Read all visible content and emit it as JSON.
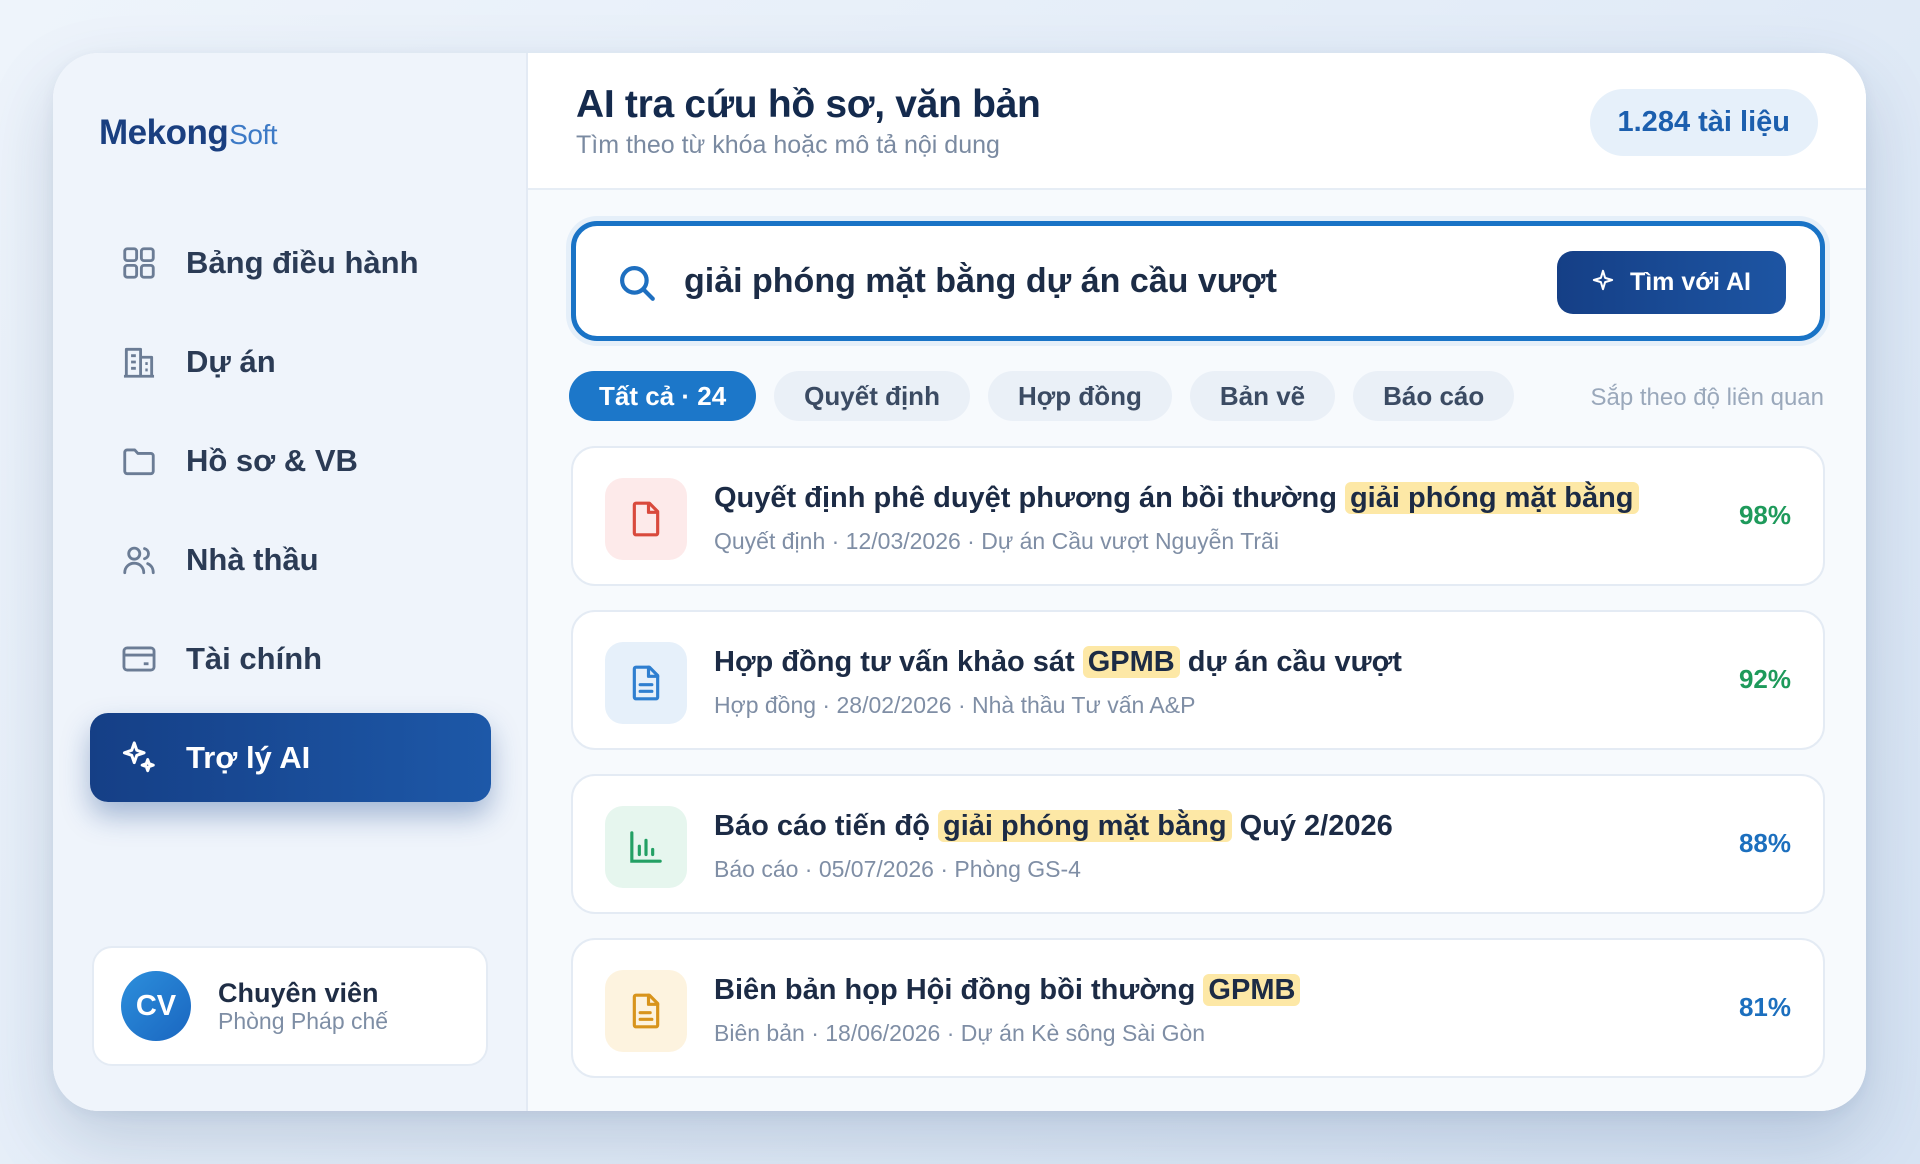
{
  "brand": {
    "name_main": "Mekong",
    "name_suffix": "Soft"
  },
  "sidebar": {
    "items": [
      {
        "label": "Bảng điều hành",
        "icon": "grid-icon"
      },
      {
        "label": "Dự án",
        "icon": "building-icon"
      },
      {
        "label": "Hồ sơ & VB",
        "icon": "folder-icon"
      },
      {
        "label": "Nhà thầu",
        "icon": "users-icon"
      },
      {
        "label": "Tài chính",
        "icon": "wallet-icon"
      },
      {
        "label": "Trợ lý AI",
        "icon": "sparkles-icon",
        "active": true
      }
    ]
  },
  "user": {
    "initials": "CV",
    "name": "Chuyên viên",
    "department": "Phòng Pháp chế"
  },
  "header": {
    "title": "AI tra cứu hồ sơ, văn bản",
    "subtitle": "Tìm theo từ khóa hoặc mô tả nội dung",
    "doc_count": "1.284 tài liệu"
  },
  "search": {
    "value": "giải phóng mặt bằng dự án cầu vượt",
    "button_label": "Tìm với AI"
  },
  "filters": [
    "Tất cả · 24",
    "Quyết định",
    "Hợp đồng",
    "Bản vẽ",
    "Báo cáo"
  ],
  "active_filter": 0,
  "sort_label": "Sắp theo độ liên quan",
  "results": [
    {
      "title_before": "Quyết định phê duyệt phương án bồi thường ",
      "highlight": "giải phóng mặt bằng",
      "title_after": "",
      "meta": "Quyết định · 12/03/2026 · Dự án Cầu vượt Nguyễn Trãi",
      "score": "98%",
      "icon": "document-icon",
      "icon_color": "#d94a3d",
      "icon_bg": "#fdeaea",
      "score_color": "#1e9a5b"
    },
    {
      "title_before": "Hợp đồng tư vấn khảo sát ",
      "highlight": "GPMB",
      "title_after": " dự án cầu vượt",
      "meta": "Hợp đồng · 28/02/2026 · Nhà thầu Tư vấn A&P",
      "score": "92%",
      "icon": "contract-icon",
      "icon_color": "#2f7fd0",
      "icon_bg": "#e6f0fa",
      "score_color": "#1e9a5b"
    },
    {
      "title_before": "Báo cáo tiến độ ",
      "highlight": "giải phóng mặt bằng",
      "title_after": " Quý 2/2026",
      "meta": "Báo cáo · 05/07/2026 · Phòng GS-4",
      "score": "88%",
      "icon": "chart-icon",
      "icon_color": "#23a064",
      "icon_bg": "#e6f6ee",
      "score_color": "#1c6fbe"
    },
    {
      "title_before": "Biên bản họp Hội đồng bồi thường ",
      "highlight": "GPMB",
      "title_after": "",
      "meta": "Biên bản · 18/06/2026 · Dự án Kè sông Sài Gòn",
      "score": "81%",
      "icon": "note-icon",
      "icon_color": "#d8941c",
      "icon_bg": "#fdf3df",
      "score_color": "#1c6fbe"
    }
  ]
}
